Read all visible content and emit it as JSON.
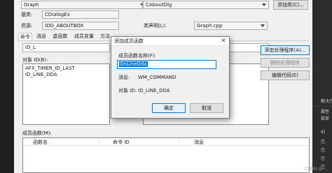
{
  "window": {
    "top_left_combo": "Graph",
    "top_right_combo": "CAboutDlg",
    "add_class_button": "添加类(C)...",
    "base_label": "基类:",
    "base_value": "CDialogEx",
    "resource_label": "资源:",
    "resource_value": "IDD_ABOUTBOX",
    "class_file_label": "类声明(L):",
    "class_file_value": "Graph.cpp"
  },
  "tabs": [
    "命令",
    "消息",
    "虚函数",
    "成员变量",
    "方法"
  ],
  "search_value": "ID_L",
  "object_ids_label": "对象 ID(B):",
  "object_ids": [
    "AFX_TIMER_ID_LAST",
    "ID_LINE_DDA"
  ],
  "buttons": {
    "add_handler": "添加处理程序(A)...",
    "delete_handler": "删除处理程序",
    "edit_code": "编辑代码(E)"
  },
  "members_label": "成员函数(M):",
  "members_columns": [
    "函数名",
    "命令 ID",
    "消息"
  ],
  "dialog": {
    "title": "添加成员函数",
    "name_label": "成员函数名称(F):",
    "name_value": "OnLineDda",
    "message_label": "消息:",
    "message_value": "WM_COMMAND",
    "object_id_label": "对象 ID:",
    "object_id_value": "ID_LINE_DDA",
    "ok": "确定",
    "cancel": "取消"
  },
  "sidebar": {
    "items": [
      "解决方",
      "属性",
      "菜单",
      "ID",
      "已",
      "已",
      "已",
      "已"
    ]
  },
  "watermark": "CSDN @ …",
  "colors": {
    "accent": "#0078d7",
    "selection": "#0078d7",
    "dark_bg": "#1e1e1e"
  }
}
